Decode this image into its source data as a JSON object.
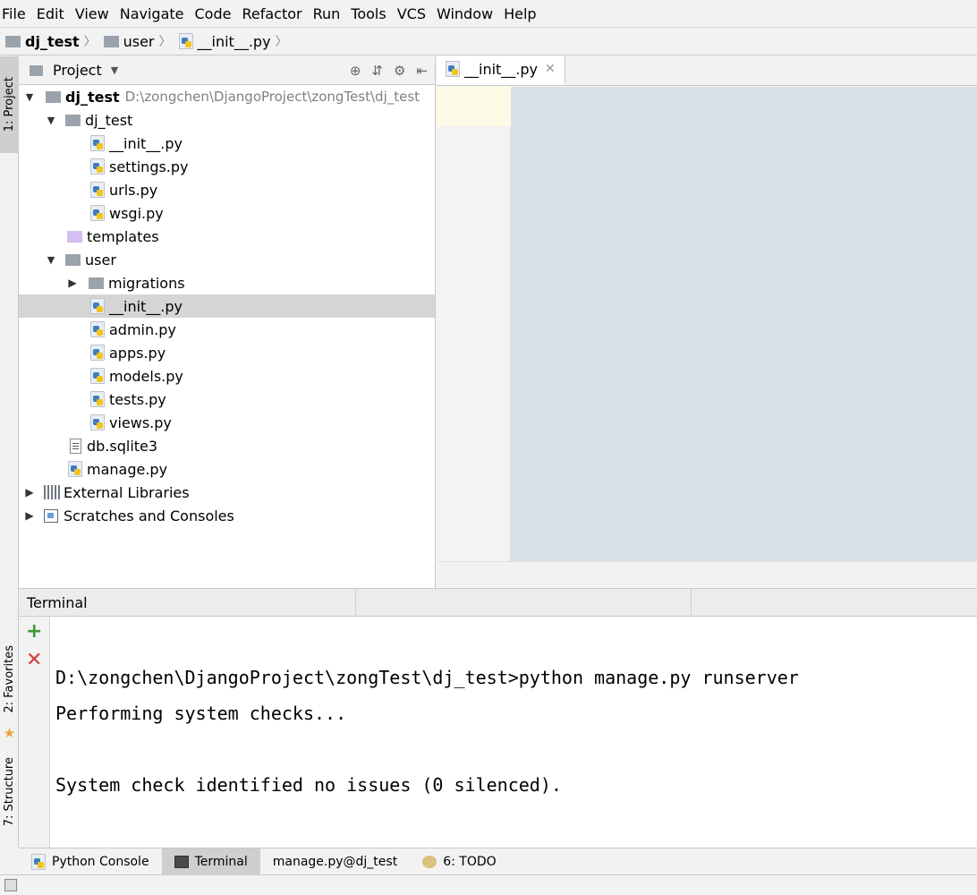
{
  "menu": {
    "items": [
      "File",
      "Edit",
      "View",
      "Navigate",
      "Code",
      "Refactor",
      "Run",
      "Tools",
      "VCS",
      "Window",
      "Help"
    ]
  },
  "breadcrumb": {
    "project": "dj_test",
    "folder": "user",
    "file": "__init__.py"
  },
  "left_stripe": {
    "project_tab": "1: Project",
    "favorites_tab": "2: Favorites",
    "structure_tab": "7: Structure"
  },
  "project_panel": {
    "title": "Project",
    "tree": [
      {
        "label": "dj_test",
        "path": "D:\\zongchen\\DjangoProject\\zongTest\\dj_test"
      },
      {
        "label": "dj_test"
      },
      {
        "label": "__init__.py"
      },
      {
        "label": "settings.py"
      },
      {
        "label": "urls.py"
      },
      {
        "label": "wsgi.py"
      },
      {
        "label": "templates"
      },
      {
        "label": "user"
      },
      {
        "label": "migrations"
      },
      {
        "label": "__init__.py"
      },
      {
        "label": "admin.py"
      },
      {
        "label": "apps.py"
      },
      {
        "label": "models.py"
      },
      {
        "label": "tests.py"
      },
      {
        "label": "views.py"
      },
      {
        "label": "db.sqlite3"
      },
      {
        "label": "manage.py"
      },
      {
        "label": "External Libraries"
      },
      {
        "label": "Scratches and Consoles"
      }
    ]
  },
  "editor": {
    "tab_label": "__init__.py"
  },
  "terminal": {
    "title": "Terminal",
    "lines": [
      "D:\\zongchen\\DjangoProject\\zongTest\\dj_test>python manage.py runserver",
      "Performing system checks...",
      "",
      "System check identified no issues (0 silenced)."
    ]
  },
  "bottom_tabs": {
    "python_console": "Python Console",
    "terminal": "Terminal",
    "run_config": "manage.py@dj_test",
    "todo": "6: TODO"
  },
  "colors": {
    "code_area": "#d8e1ea",
    "selected_row": "#d5d5d5",
    "add_icon": "#3b9a3b",
    "close_icon": "#d33b3b"
  }
}
